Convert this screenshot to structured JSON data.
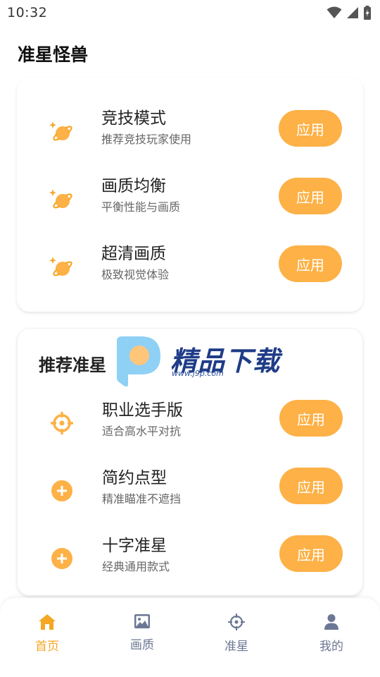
{
  "status_bar": {
    "time": "10:32"
  },
  "page": {
    "title": "准星怪兽"
  },
  "presets_card": {
    "items": [
      {
        "title": "竞技模式",
        "subtitle": "推荐竞技玩家使用",
        "button": "应用",
        "icon": "sparkle-planet-icon"
      },
      {
        "title": "画质均衡",
        "subtitle": "平衡性能与画质",
        "button": "应用",
        "icon": "sparkle-planet-icon"
      },
      {
        "title": "超清画质",
        "subtitle": "极致视觉体验",
        "button": "应用",
        "icon": "sparkle-planet-icon"
      }
    ]
  },
  "crosshair_card": {
    "heading": "推荐准星",
    "items": [
      {
        "title": "职业选手版",
        "subtitle": "适合高水平对抗",
        "button": "应用",
        "icon": "crosshair-target-icon"
      },
      {
        "title": "简约点型",
        "subtitle": "精准瞄准不遮挡",
        "button": "应用",
        "icon": "plus-circle-icon"
      },
      {
        "title": "十字准星",
        "subtitle": "经典通用款式",
        "button": "应用",
        "icon": "plus-circle-icon"
      }
    ]
  },
  "watermark": {
    "text": "精品下载",
    "url": "www.j9p.com"
  },
  "tab_bar": {
    "tabs": [
      {
        "label": "首页",
        "icon": "home-icon",
        "active": true
      },
      {
        "label": "画质",
        "icon": "image-icon",
        "active": false
      },
      {
        "label": "准星",
        "icon": "crosshair-icon",
        "active": false
      },
      {
        "label": "我的",
        "icon": "user-icon",
        "active": false
      }
    ]
  },
  "colors": {
    "accent": "#fdb146",
    "inactive_tab": "#6b7794",
    "active_tab": "#f5a623"
  }
}
